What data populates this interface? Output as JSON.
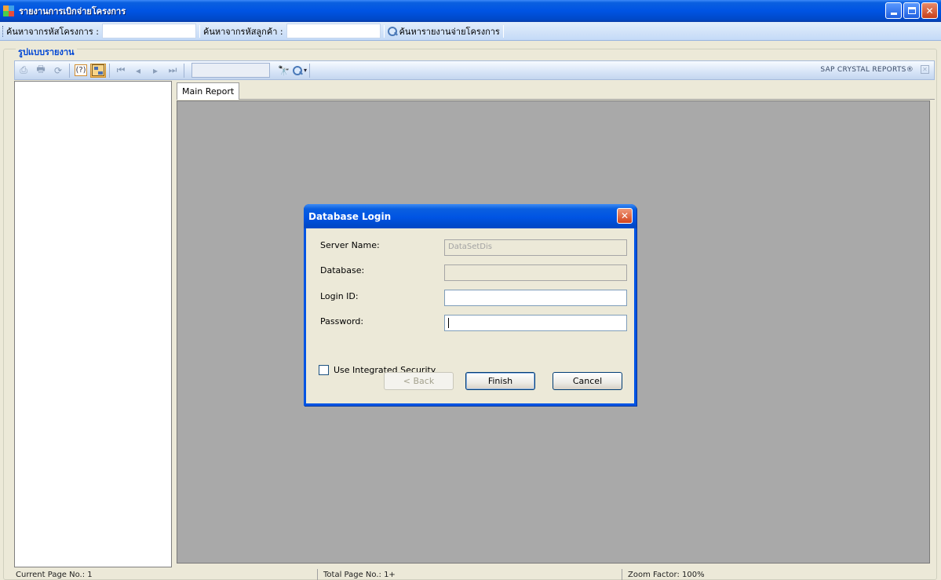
{
  "window": {
    "title": "รายงานการเบิกจ่ายโครงการ",
    "buttons": [
      "minimize",
      "maximize",
      "close"
    ]
  },
  "searchbar": {
    "project_code_label": "ค้นหาจากรหัสโครงการ :",
    "project_code_value": "",
    "customer_code_label": "ค้นหาจากรหัสลูกค้า :",
    "customer_code_value": "",
    "search_button_label": "ค้นหารายงานจ่ายโครงการ"
  },
  "group": {
    "label": "รูปแบบรายงาน"
  },
  "crystal_toolbar": {
    "brand": "SAP CRYSTAL REPORTS®",
    "page_value": ""
  },
  "tabs": [
    {
      "label": "Main Report"
    }
  ],
  "status": {
    "current_page": "Current Page No.: 1",
    "total_page": "Total Page No.: 1+",
    "zoom": "Zoom Factor: 100%"
  },
  "dialog": {
    "title": "Database Login",
    "server_name_label": "Server Name:",
    "server_name_value": "DataSetDis",
    "database_label": "Database:",
    "database_value": "",
    "login_id_label": "Login ID:",
    "login_id_value": "",
    "password_label": "Password:",
    "password_value": "",
    "integrated_security_label": "Use Integrated Security",
    "integrated_security_checked": false,
    "back_label": "< Back",
    "finish_label": "Finish",
    "cancel_label": "Cancel"
  }
}
